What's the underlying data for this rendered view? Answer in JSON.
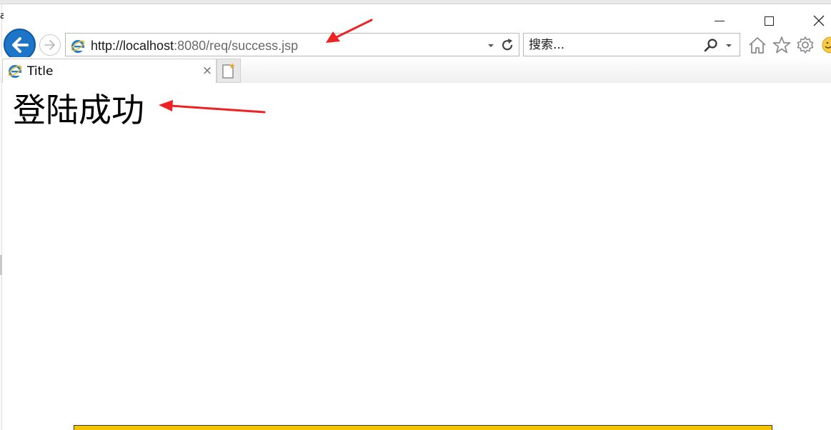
{
  "browser": {
    "address_bar": {
      "url_host_part": "http://localhost",
      "url_rest_part": ":8080/req/success.jsp"
    },
    "search_bar": {
      "placeholder": "搜索..."
    },
    "tab": {
      "title": "Title",
      "close_glyph": "×"
    },
    "icons": [
      "back-arrow-icon",
      "forward-arrow-icon",
      "ie-logo-icon",
      "dropdown-arrow-icon",
      "refresh-icon",
      "search-magnifier-icon",
      "home-icon",
      "star-icon",
      "gear-icon",
      "smiley-icon",
      "new-tab-icon",
      "minimize-icon",
      "maximize-icon",
      "close-icon"
    ]
  },
  "page": {
    "heading": "登陆成功"
  },
  "left_cut_text": "a",
  "colors": {
    "back_button": "#1c75c7",
    "annotation_arrow": "#ee2222",
    "bottom_bar": "#f5c400"
  }
}
